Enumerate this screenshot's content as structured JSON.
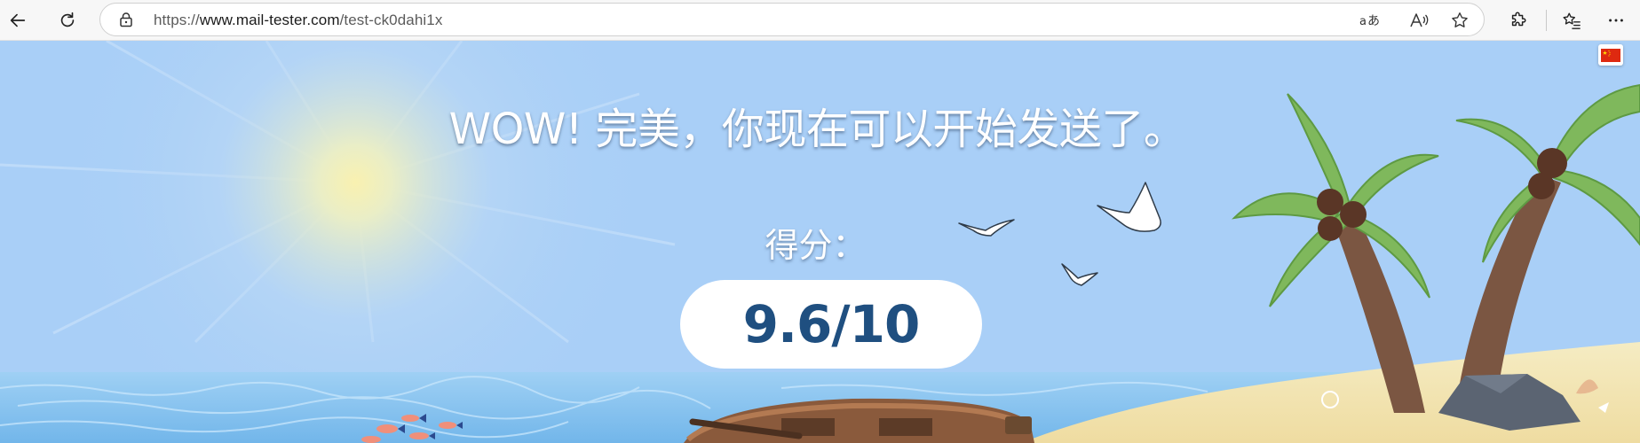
{
  "browser": {
    "url_scheme": "https://",
    "url_host": "www.mail-tester.com",
    "url_path": "/test-ck0dahi1x",
    "read_aloud_icon": "A⁾"
  },
  "page": {
    "headline": "WOW! 完美，你现在可以开始发送了。",
    "score_label": "得分：",
    "score_value": "9.6/10",
    "language_flag": "china-flag"
  },
  "colors": {
    "sky": "#a9cff7",
    "sea": "#7fbfe9",
    "sand": "#f3e6b5",
    "score_text": "#1f4f80"
  }
}
